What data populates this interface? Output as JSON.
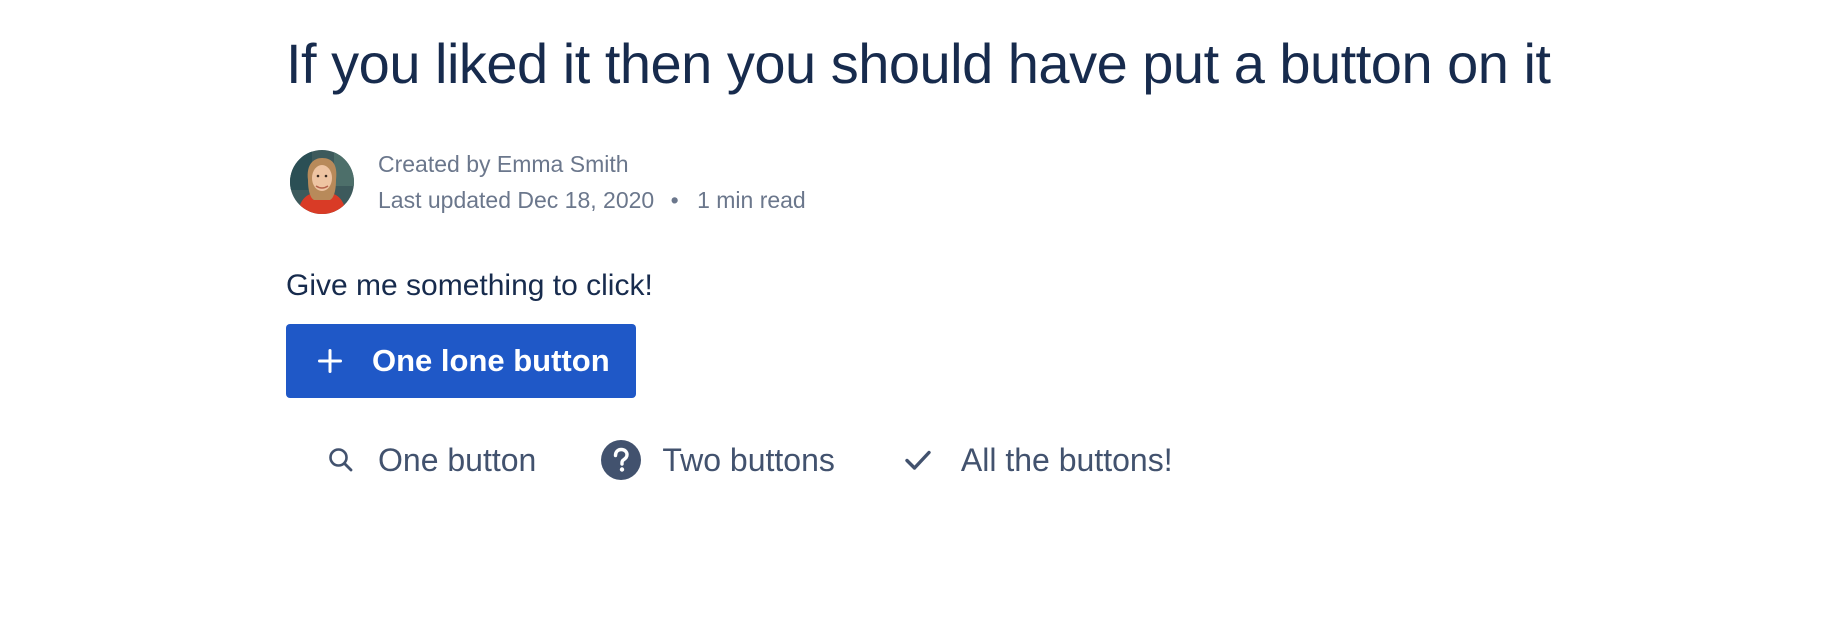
{
  "page": {
    "title": "If you liked it then you should have put a button on it"
  },
  "byline": {
    "created_by": "Created by Emma Smith",
    "last_updated": "Last updated Dec 18, 2020",
    "separator": "•",
    "read_time": "1 min read",
    "avatar_icon": "user-avatar-photo"
  },
  "content": {
    "intro": "Give me something to click!",
    "primary_button": {
      "label": "One lone button",
      "icon": "plus-icon",
      "color": "#1f58c7"
    },
    "link_buttons": [
      {
        "label": "One button",
        "icon": "search-icon"
      },
      {
        "label": "Two buttons",
        "icon": "question-circle-icon"
      },
      {
        "label": "All the buttons!",
        "icon": "check-icon"
      }
    ]
  },
  "colors": {
    "heading": "#172b4d",
    "subtle_text": "#6b778c",
    "link_text": "#42526e",
    "primary": "#1f58c7"
  }
}
